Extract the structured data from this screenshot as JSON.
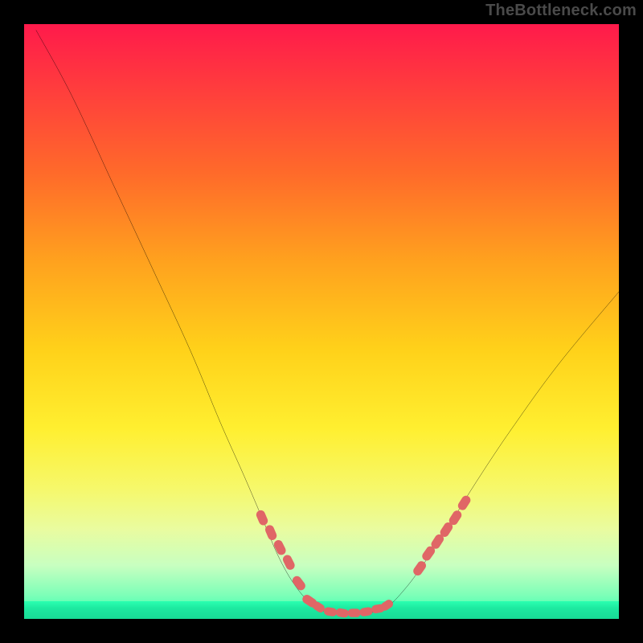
{
  "watermark": "TheBottleneck.com",
  "colors": {
    "frame_bg": "#000000",
    "marker_fill": "#e06666",
    "curve_stroke": "#000000",
    "gradient_stops": [
      "#ff1a4b",
      "#ff3a3e",
      "#ff6a2a",
      "#ffa21e",
      "#ffd21a",
      "#ffef30",
      "#f6f86a",
      "#e9fca0",
      "#c8ffc0",
      "#7dffb8",
      "#2bffb0"
    ]
  },
  "chart_data": {
    "type": "line",
    "title": "",
    "xlabel": "",
    "ylabel": "",
    "xlim": [
      0,
      100
    ],
    "ylim": [
      0,
      100
    ],
    "grid": false,
    "curve": [
      {
        "x": 2,
        "y": 99
      },
      {
        "x": 8,
        "y": 88
      },
      {
        "x": 15,
        "y": 73
      },
      {
        "x": 22,
        "y": 58
      },
      {
        "x": 28,
        "y": 45
      },
      {
        "x": 33,
        "y": 33
      },
      {
        "x": 37,
        "y": 24
      },
      {
        "x": 40,
        "y": 17
      },
      {
        "x": 43,
        "y": 10
      },
      {
        "x": 46,
        "y": 5
      },
      {
        "x": 49,
        "y": 2
      },
      {
        "x": 52,
        "y": 1
      },
      {
        "x": 55,
        "y": 1
      },
      {
        "x": 58,
        "y": 1
      },
      {
        "x": 61,
        "y": 2
      },
      {
        "x": 64,
        "y": 5
      },
      {
        "x": 67,
        "y": 9
      },
      {
        "x": 71,
        "y": 15
      },
      {
        "x": 76,
        "y": 23
      },
      {
        "x": 82,
        "y": 32
      },
      {
        "x": 90,
        "y": 43
      },
      {
        "x": 100,
        "y": 55
      }
    ],
    "markers_left": [
      {
        "x": 40,
        "y": 17
      },
      {
        "x": 41.5,
        "y": 14.5
      },
      {
        "x": 43,
        "y": 12
      },
      {
        "x": 44.5,
        "y": 9.5
      },
      {
        "x": 46.2,
        "y": 6
      },
      {
        "x": 48,
        "y": 3
      }
    ],
    "markers_bottom": [
      {
        "x": 49.5,
        "y": 2
      },
      {
        "x": 51.5,
        "y": 1.2
      },
      {
        "x": 53.5,
        "y": 1
      },
      {
        "x": 55.5,
        "y": 1
      },
      {
        "x": 57.5,
        "y": 1.2
      },
      {
        "x": 59.5,
        "y": 1.7
      },
      {
        "x": 61,
        "y": 2.3
      }
    ],
    "markers_right": [
      {
        "x": 66.5,
        "y": 8.5
      },
      {
        "x": 68,
        "y": 11
      },
      {
        "x": 69.5,
        "y": 13
      },
      {
        "x": 71,
        "y": 15
      },
      {
        "x": 72.5,
        "y": 17
      },
      {
        "x": 74,
        "y": 19.5
      }
    ]
  }
}
